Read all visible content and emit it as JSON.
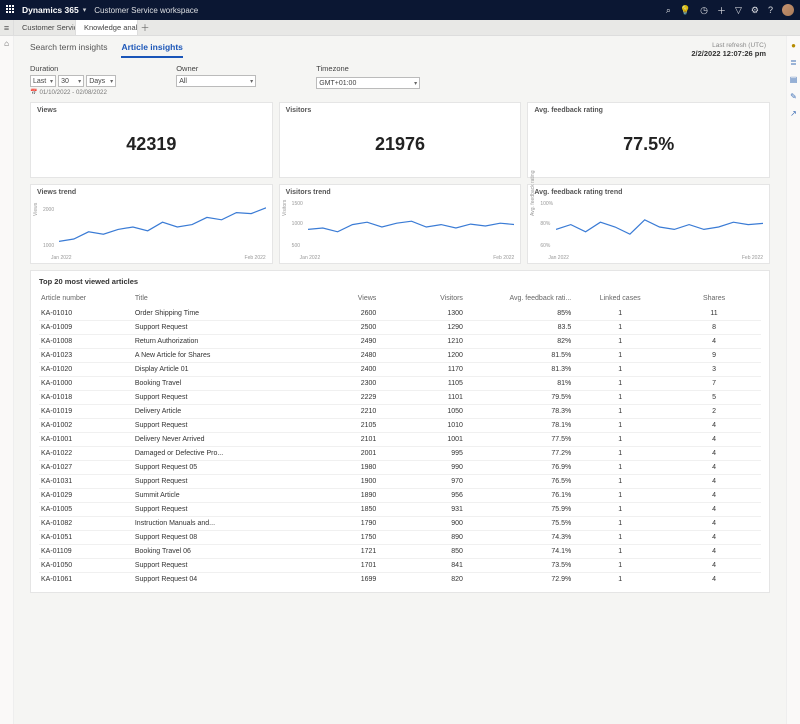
{
  "topbar": {
    "brand": "Dynamics 365",
    "workspace": "Customer Service workspace"
  },
  "tabs": {
    "t1": "Customer Service ...",
    "t2": "Knowledge analytics - Ins..."
  },
  "refresh": {
    "label": "Last refresh (UTC)",
    "ts": "2/2/2022 12:07:26 pm"
  },
  "subtabs": {
    "search": "Search term insights",
    "article": "Article insights"
  },
  "filters": {
    "duration_label": "Duration",
    "duration_last": "Last",
    "duration_num": "30",
    "duration_unit": "Days",
    "owner_label": "Owner",
    "owner_val": "All",
    "tz_label": "Timezone",
    "tz_val": "GMT+01:00",
    "daterange": "01/10/2022 - 02/08/2022"
  },
  "cards": {
    "views_label": "Views",
    "views_val": "42319",
    "visitors_label": "Visitors",
    "visitors_val": "21976",
    "rating_label": "Avg. feedback rating",
    "rating_val": "77.5%"
  },
  "trends": {
    "views": {
      "title": "Views trend",
      "ylabel": "Views",
      "y0": "1000",
      "y1": "2000",
      "xl": "Jan 2022",
      "xr": "Feb 2022"
    },
    "visitors": {
      "title": "Visitors trend",
      "ylabel": "Visitors",
      "y0": "500",
      "y1": "1000",
      "y2": "1500",
      "xl": "Jan 2022",
      "xr": "Feb 2022"
    },
    "rating": {
      "title": "Avg. feedback rating trend",
      "ylabel": "Avg. feedback rating",
      "y0": "60%",
      "y1": "80%",
      "y2": "100%",
      "xl": "Jan 2022",
      "xr": "Feb 2022"
    }
  },
  "table": {
    "title": "Top 20 most viewed articles",
    "headers": {
      "num": "Article number",
      "title": "Title",
      "views": "Views",
      "visitors": "Visitors",
      "rating": "Avg. feedback rati...",
      "linked": "Linked cases",
      "shares": "Shares"
    },
    "rows": [
      {
        "n": "KA-01010",
        "t": "Order Shipping Time",
        "v": "2600",
        "vs": "1300",
        "r": "85%",
        "l": "1",
        "s": "11"
      },
      {
        "n": "KA-01009",
        "t": "Support Request",
        "v": "2500",
        "vs": "1290",
        "r": "83.5",
        "l": "1",
        "s": "8"
      },
      {
        "n": "KA-01008",
        "t": "Return Authorization",
        "v": "2490",
        "vs": "1210",
        "r": "82%",
        "l": "1",
        "s": "4"
      },
      {
        "n": "KA-01023",
        "t": "A New Article for Shares",
        "v": "2480",
        "vs": "1200",
        "r": "81.5%",
        "l": "1",
        "s": "9"
      },
      {
        "n": "KA-01020",
        "t": "Display Article 01",
        "v": "2400",
        "vs": "1170",
        "r": "81.3%",
        "l": "1",
        "s": "3"
      },
      {
        "n": "KA-01000",
        "t": "Booking Travel",
        "v": "2300",
        "vs": "1105",
        "r": "81%",
        "l": "1",
        "s": "7"
      },
      {
        "n": "KA-01018",
        "t": "Support Request",
        "v": "2229",
        "vs": "1101",
        "r": "79.5%",
        "l": "1",
        "s": "5"
      },
      {
        "n": "KA-01019",
        "t": "Delivery Article",
        "v": "2210",
        "vs": "1050",
        "r": "78.3%",
        "l": "1",
        "s": "2"
      },
      {
        "n": "KA-01002",
        "t": "Support Request",
        "v": "2105",
        "vs": "1010",
        "r": "78.1%",
        "l": "1",
        "s": "4"
      },
      {
        "n": "KA-01001",
        "t": "Delivery Never Arrived",
        "v": "2101",
        "vs": "1001",
        "r": "77.5%",
        "l": "1",
        "s": "4"
      },
      {
        "n": "KA-01022",
        "t": "Damaged or Defective Pro...",
        "v": "2001",
        "vs": "995",
        "r": "77.2%",
        "l": "1",
        "s": "4"
      },
      {
        "n": "KA-01027",
        "t": "Support Request 05",
        "v": "1980",
        "vs": "990",
        "r": "76.9%",
        "l": "1",
        "s": "4"
      },
      {
        "n": "KA-01031",
        "t": "Support Request",
        "v": "1900",
        "vs": "970",
        "r": "76.5%",
        "l": "1",
        "s": "4"
      },
      {
        "n": "KA-01029",
        "t": "Summit Article",
        "v": "1890",
        "vs": "956",
        "r": "76.1%",
        "l": "1",
        "s": "4"
      },
      {
        "n": "KA-01005",
        "t": "Support Request",
        "v": "1850",
        "vs": "931",
        "r": "75.9%",
        "l": "1",
        "s": "4"
      },
      {
        "n": "KA-01082",
        "t": "Instruction Manuals and...",
        "v": "1790",
        "vs": "900",
        "r": "75.5%",
        "l": "1",
        "s": "4"
      },
      {
        "n": "KA-01051",
        "t": "Support Request 08",
        "v": "1750",
        "vs": "890",
        "r": "74.3%",
        "l": "1",
        "s": "4"
      },
      {
        "n": "KA-01109",
        "t": "Booking Travel 06",
        "v": "1721",
        "vs": "850",
        "r": "74.1%",
        "l": "1",
        "s": "4"
      },
      {
        "n": "KA-01050",
        "t": "Support Request",
        "v": "1701",
        "vs": "841",
        "r": "73.5%",
        "l": "1",
        "s": "4"
      },
      {
        "n": "KA-01061",
        "t": "Support Request 04",
        "v": "1699",
        "vs": "820",
        "r": "72.9%",
        "l": "1",
        "s": "4"
      }
    ]
  },
  "chart_data": [
    {
      "type": "line",
      "title": "Views trend",
      "xlabel": "",
      "ylabel": "Views",
      "ylim": [
        1000,
        2000
      ],
      "x_range": [
        "Jan 2022",
        "Feb 2022"
      ],
      "values": [
        1200,
        1250,
        1400,
        1350,
        1450,
        1500,
        1420,
        1600,
        1500,
        1550,
        1700,
        1650,
        1800,
        1780,
        1900
      ]
    },
    {
      "type": "line",
      "title": "Visitors trend",
      "xlabel": "",
      "ylabel": "Visitors",
      "ylim": [
        500,
        1500
      ],
      "x_range": [
        "Jan 2022",
        "Feb 2022"
      ],
      "values": [
        950,
        980,
        900,
        1050,
        1100,
        1000,
        1080,
        1120,
        1000,
        1050,
        980,
        1060,
        1020,
        1080,
        1050
      ]
    },
    {
      "type": "line",
      "title": "Avg. feedback rating trend",
      "xlabel": "",
      "ylabel": "Avg. feedback rating",
      "ylim": [
        60,
        100
      ],
      "x_range": [
        "Jan 2022",
        "Feb 2022"
      ],
      "values": [
        78,
        82,
        76,
        84,
        80,
        74,
        86,
        80,
        78,
        82,
        78,
        80,
        84,
        82,
        83
      ]
    }
  ]
}
